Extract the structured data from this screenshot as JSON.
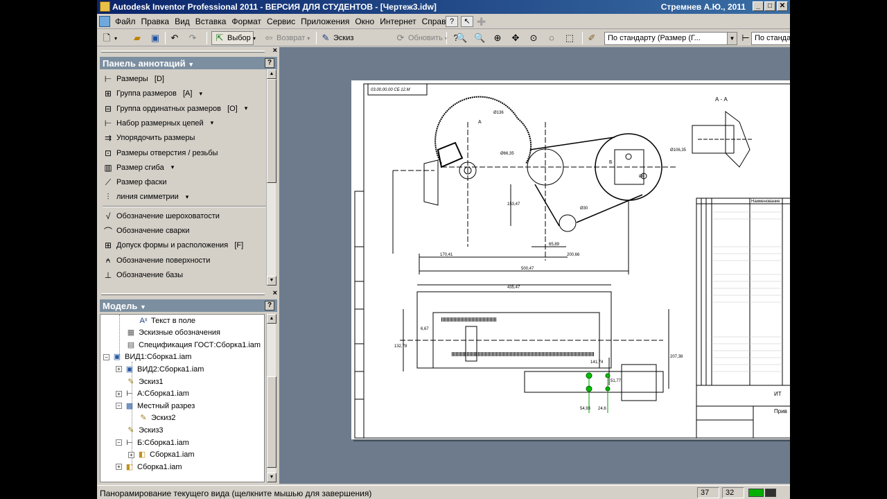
{
  "window": {
    "title": "Autodesk Inventor Professional 2011 - ВЕРСИЯ ДЛЯ СТУДЕНТОВ - [Чертеж3.idw]",
    "user": "Стремнев А.Ю., 2011",
    "minimize": "_",
    "maximize": "□",
    "close": "✕"
  },
  "menu": {
    "items": [
      "Файл",
      "Правка",
      "Вид",
      "Вставка",
      "Формат",
      "Сервис",
      "Приложения",
      "Окно",
      "Интернет",
      "Справка"
    ],
    "help_icon": "question-icon",
    "arrow_icon": "pointer-arrow-icon"
  },
  "toolbar": {
    "select_label": "Выбор",
    "return_label": "Возврат",
    "sketch_label": "Эскиз",
    "update_label": "Обновить",
    "style_combo": "По стандарту (Размер (Г...",
    "layer_combo": "По стандар"
  },
  "annotation_panel": {
    "title": "Панель аннотаций",
    "help": "?",
    "close": "×",
    "items": [
      {
        "label": "Размеры   [D]",
        "icon": "dimension-icon",
        "dropdown": false
      },
      {
        "label": "Группа размеров   [A]",
        "icon": "dimension-group-icon",
        "dropdown": true
      },
      {
        "label": "Группа ординатных размеров   [O]",
        "icon": "ordinate-dimension-icon",
        "dropdown": true
      },
      {
        "label": "Набор размерных цепей",
        "icon": "chain-dimension-icon",
        "dropdown": true
      },
      {
        "label": "Упорядочить размеры",
        "icon": "arrange-dimensions-icon",
        "dropdown": false
      },
      {
        "label": "Размеры отверстия / резьбы",
        "icon": "hole-thread-icon",
        "dropdown": false
      },
      {
        "label": "Размер сгиба",
        "icon": "bend-icon",
        "dropdown": true
      },
      {
        "label": "Размер фаски",
        "icon": "chamfer-icon",
        "dropdown": false
      },
      {
        "label": "линия симметрии",
        "icon": "centerline-icon",
        "dropdown": true
      },
      {
        "label": "Обозначение шероховатости",
        "icon": "surface-texture-icon",
        "dropdown": false
      },
      {
        "label": "Обозначение сварки",
        "icon": "weld-symbol-icon",
        "dropdown": false
      },
      {
        "label": "Допуск формы и расположения   [F]",
        "icon": "feature-control-frame-icon",
        "dropdown": false
      },
      {
        "label": "Обозначение поверхности",
        "icon": "surface-identifier-icon",
        "dropdown": false
      },
      {
        "label": "Обозначение базы",
        "icon": "datum-icon",
        "dropdown": false
      }
    ]
  },
  "model_panel": {
    "title": "Модель",
    "help": "?",
    "close": "×",
    "tree": [
      {
        "label": "Текст в поле",
        "icon": "field-text-icon",
        "level": 3,
        "expander": ""
      },
      {
        "label": "Эскизные обозначения",
        "icon": "sketched-symbols-icon",
        "level": 2,
        "expander": ""
      },
      {
        "label": "Спецификация ГОСТ:Сборка1.iam",
        "icon": "parts-list-icon",
        "level": 2,
        "expander": ""
      },
      {
        "label": "ВИД1:Сборка1.iam",
        "icon": "view-icon",
        "level": 1,
        "expander": "−"
      },
      {
        "label": "ВИД2:Сборка1.iam",
        "icon": "view-icon",
        "level": 2,
        "expander": "+"
      },
      {
        "label": "Эскиз1",
        "icon": "sketch-icon",
        "level": 2,
        "expander": ""
      },
      {
        "label": "А:Сборка1.iam",
        "icon": "section-view-icon",
        "level": 2,
        "expander": "+"
      },
      {
        "label": "Местный разрез",
        "icon": "breakout-view-icon",
        "level": 2,
        "expander": "−"
      },
      {
        "label": "Эскиз2",
        "icon": "sketch-icon",
        "level": 3,
        "expander": ""
      },
      {
        "label": "Эскиз3",
        "icon": "sketch-icon",
        "level": 2,
        "expander": ""
      },
      {
        "label": "Б:Сборка1.iam",
        "icon": "section-view-icon",
        "level": 2,
        "expander": "−"
      },
      {
        "label": "Сборка1.iam",
        "icon": "assembly-icon",
        "level": 3,
        "expander": "+"
      },
      {
        "label": "Сборка1.iam",
        "icon": "assembly-icon",
        "level": 2,
        "expander": "+"
      }
    ]
  },
  "drawing": {
    "stamp_text": "03.00.00.00 СБ 12.М",
    "section_a": "А - А",
    "label_a": "А",
    "label_b": "Б",
    "dimensions": [
      "Ø136",
      "Ø66,35",
      "Ø106,35",
      "Ø30",
      "Ø8",
      "65,89",
      "170,41",
      "200,66",
      "153,47",
      "500,47",
      "435,47",
      "141,74",
      "207,38",
      "132,78",
      "54,93",
      "24,6",
      "51,77",
      "6,67"
    ],
    "title_block": "Наименование",
    "corner_text": "ИТ",
    "corner_text2": "Прив"
  },
  "status": {
    "message": "Панорамирование текущего вида (щелкните мышью для завершения)",
    "cell1": "37",
    "cell2": "32"
  }
}
